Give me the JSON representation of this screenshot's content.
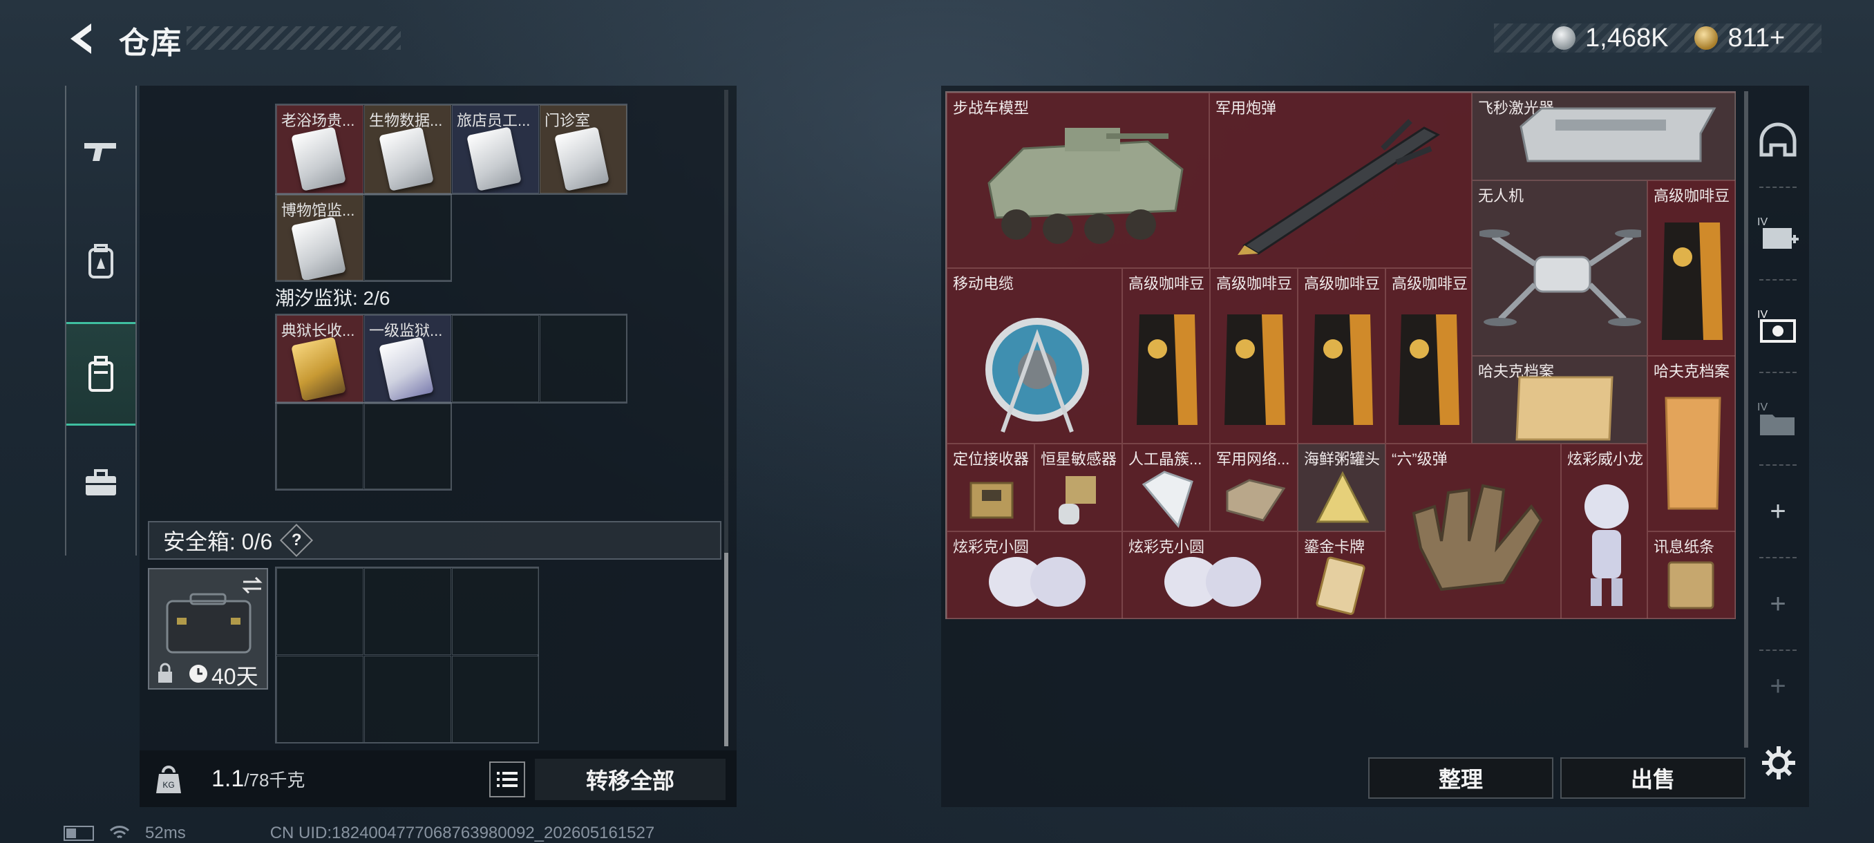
{
  "header": {
    "title": "仓库",
    "currency_silver": "1,468K",
    "currency_gold": "811+"
  },
  "left_rail": {
    "items": [
      {
        "name": "weapon",
        "icon": "gun-icon",
        "active": false
      },
      {
        "name": "armor",
        "icon": "backpack-icon",
        "active": false
      },
      {
        "name": "container",
        "icon": "case-icon",
        "active": true
      },
      {
        "name": "tools",
        "icon": "toolbox-icon",
        "active": false
      }
    ]
  },
  "key_section_1": {
    "cells": [
      {
        "label": "老浴场贵...",
        "color": "red"
      },
      {
        "label": "生物数据...",
        "color": "brown"
      },
      {
        "label": "旅店员工...",
        "color": "navy"
      },
      {
        "label": "门诊室",
        "color": "brown"
      },
      {
        "label": "博物馆监...",
        "color": "brown"
      }
    ]
  },
  "key_section_2": {
    "title": "潮汐监狱: 2/6",
    "cells": [
      {
        "label": "典狱长收...",
        "color": "red"
      },
      {
        "label": "一级监狱...",
        "color": "navy"
      }
    ]
  },
  "safe_box": {
    "label": "安全箱: 0/6",
    "help": "?",
    "duration": "40天"
  },
  "weight": {
    "current": "1.1",
    "max": "/78千克"
  },
  "buttons": {
    "transfer_all": "转移全部",
    "organize": "整理",
    "sell": "出售"
  },
  "stash_items": [
    {
      "label": "步战车模型"
    },
    {
      "label": "军用炮弹"
    },
    {
      "label": "飞秒激光器"
    },
    {
      "label": "无人机"
    },
    {
      "label": "高级咖啡豆"
    },
    {
      "label": "移动电缆"
    },
    {
      "label": "高级咖啡豆"
    },
    {
      "label": "高级咖啡豆"
    },
    {
      "label": "高级咖啡豆"
    },
    {
      "label": "高级咖啡豆"
    },
    {
      "label": "哈夫克档案"
    },
    {
      "label": "哈夫克档案"
    },
    {
      "label": "定位接收器"
    },
    {
      "label": "恒星敏感器"
    },
    {
      "label": "人工晶簇..."
    },
    {
      "label": "军用网络..."
    },
    {
      "label": "海鲜粥罐头"
    },
    {
      "label": "“六”级弹"
    },
    {
      "label": "炫彩威小龙"
    },
    {
      "label": "炫彩克小圆"
    },
    {
      "label": "炫彩克小圆"
    },
    {
      "label": "鎏金卡牌"
    },
    {
      "label": "讯息纸条"
    }
  ],
  "right_rail": {
    "items": [
      {
        "icon": "helmet-icon"
      },
      {
        "icon": "medkit-icon"
      },
      {
        "icon": "camera-icon"
      },
      {
        "icon": "folder-icon"
      },
      {
        "icon": "plus-icon",
        "text": "+"
      },
      {
        "icon": "plus-icon",
        "text": "+"
      },
      {
        "icon": "plus-icon",
        "text": "+"
      }
    ]
  },
  "status": {
    "ping": "52ms",
    "uid": "CN UID:1824004777068763980092_202605161527"
  }
}
